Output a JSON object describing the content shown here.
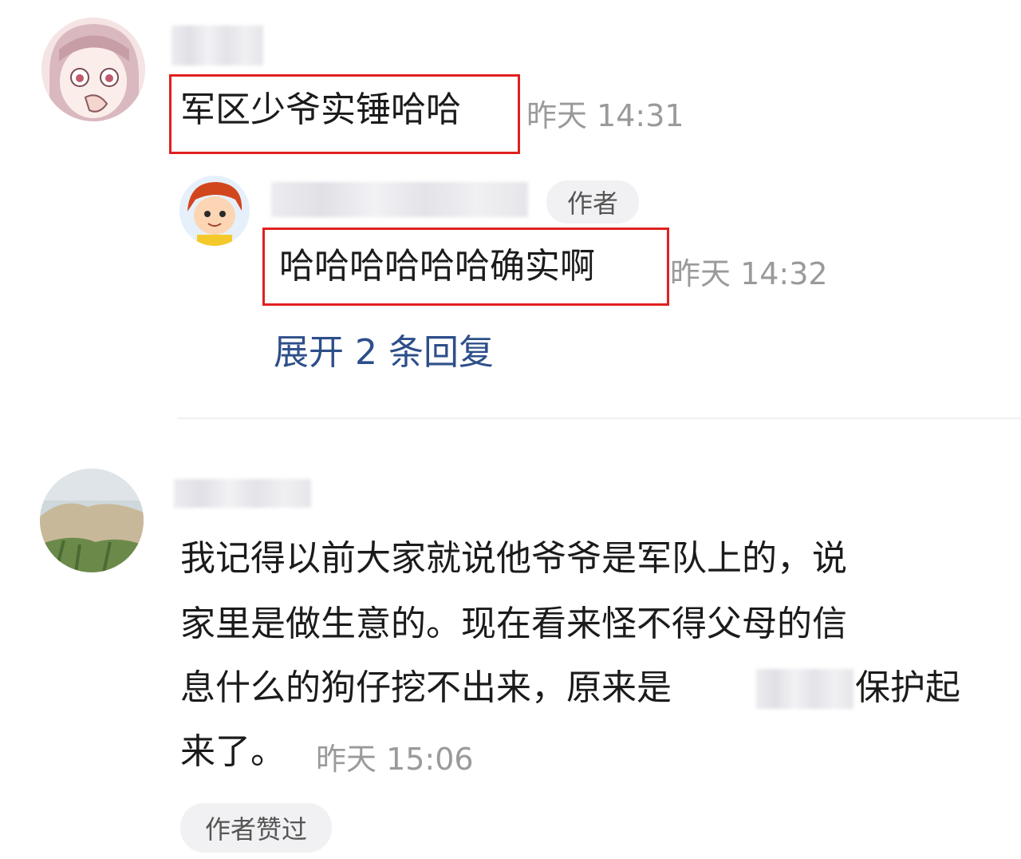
{
  "comments": [
    {
      "text": "军区少爷实锤哈哈",
      "time": "昨天 14:31"
    },
    {
      "author_tag": "作者",
      "text": "哈哈哈哈哈哈确实啊",
      "time": "昨天 14:32",
      "expand_label": "展开 2 条回复"
    },
    {
      "text_lines": [
        "我记得以前大家就说他爷爷是军队上的，说",
        "家里是做生意的。现在看来怪不得父母的信",
        "息什么的狗仔挖不出来，原来是",
        "保护起",
        "来了。"
      ],
      "time": "昨天 15:06",
      "liked_tag": "作者赞过"
    }
  ],
  "icons": {
    "avatar1": "anime-girl-avatar",
    "avatar2": "cartoon-boy-avatar",
    "avatar3": "landscape-avatar"
  },
  "colors": {
    "highlight": "#e02020",
    "link": "#2d4f8a",
    "time": "#9a9a9a"
  }
}
